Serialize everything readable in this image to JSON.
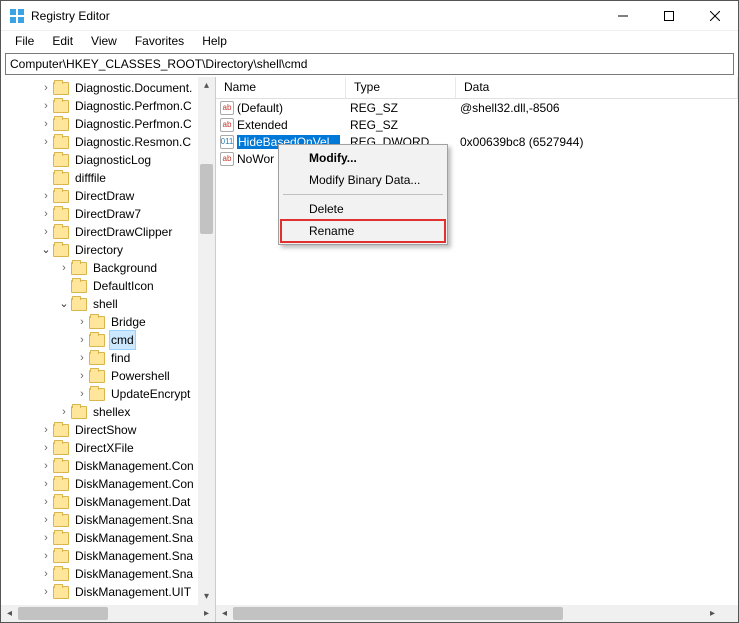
{
  "window": {
    "title": "Registry Editor"
  },
  "menu": {
    "file": "File",
    "edit": "Edit",
    "view": "View",
    "favorites": "Favorites",
    "help": "Help"
  },
  "address": "Computer\\HKEY_CLASSES_ROOT\\Directory\\shell\\cmd",
  "columns": {
    "name": "Name",
    "type": "Type",
    "data": "Data"
  },
  "values": [
    {
      "icon": "str",
      "name": "(Default)",
      "type": "REG_SZ",
      "data": "@shell32.dll,-8506",
      "selected": false
    },
    {
      "icon": "str",
      "name": "Extended",
      "type": "REG_SZ",
      "data": "",
      "selected": false
    },
    {
      "icon": "bin",
      "name": "HideBasedOnVel...",
      "type": "REG_DWORD",
      "data": "0x00639bc8 (6527944)",
      "selected": true
    },
    {
      "icon": "str",
      "name": "NoWor",
      "type": "",
      "data": "",
      "selected": false
    }
  ],
  "context_menu": {
    "modify": "Modify...",
    "modify_binary": "Modify Binary Data...",
    "delete": "Delete",
    "rename": "Rename"
  },
  "tree": [
    {
      "depth": 0,
      "tw": ">",
      "label": "Diagnostic.Document."
    },
    {
      "depth": 0,
      "tw": ">",
      "label": "Diagnostic.Perfmon.C"
    },
    {
      "depth": 0,
      "tw": ">",
      "label": "Diagnostic.Perfmon.C"
    },
    {
      "depth": 0,
      "tw": ">",
      "label": "Diagnostic.Resmon.C"
    },
    {
      "depth": 0,
      "tw": "",
      "label": "DiagnosticLog"
    },
    {
      "depth": 0,
      "tw": "",
      "label": "difffile"
    },
    {
      "depth": 0,
      "tw": ">",
      "label": "DirectDraw"
    },
    {
      "depth": 0,
      "tw": ">",
      "label": "DirectDraw7"
    },
    {
      "depth": 0,
      "tw": ">",
      "label": "DirectDrawClipper"
    },
    {
      "depth": 0,
      "tw": "v",
      "label": "Directory"
    },
    {
      "depth": 1,
      "tw": ">",
      "label": "Background"
    },
    {
      "depth": 1,
      "tw": "",
      "label": "DefaultIcon"
    },
    {
      "depth": 1,
      "tw": "v",
      "label": "shell"
    },
    {
      "depth": 2,
      "tw": ">",
      "label": "Bridge"
    },
    {
      "depth": 2,
      "tw": ">",
      "label": "cmd",
      "selected": true
    },
    {
      "depth": 2,
      "tw": ">",
      "label": "find"
    },
    {
      "depth": 2,
      "tw": ">",
      "label": "Powershell"
    },
    {
      "depth": 2,
      "tw": ">",
      "label": "UpdateEncrypt"
    },
    {
      "depth": 1,
      "tw": ">",
      "label": "shellex"
    },
    {
      "depth": 0,
      "tw": ">",
      "label": "DirectShow"
    },
    {
      "depth": 0,
      "tw": ">",
      "label": "DirectXFile"
    },
    {
      "depth": 0,
      "tw": ">",
      "label": "DiskManagement.Con"
    },
    {
      "depth": 0,
      "tw": ">",
      "label": "DiskManagement.Con"
    },
    {
      "depth": 0,
      "tw": ">",
      "label": "DiskManagement.Dat"
    },
    {
      "depth": 0,
      "tw": ">",
      "label": "DiskManagement.Sna"
    },
    {
      "depth": 0,
      "tw": ">",
      "label": "DiskManagement.Sna"
    },
    {
      "depth": 0,
      "tw": ">",
      "label": "DiskManagement.Sna"
    },
    {
      "depth": 0,
      "tw": ">",
      "label": "DiskManagement.Sna"
    },
    {
      "depth": 0,
      "tw": ">",
      "label": "DiskManagement.UIT"
    }
  ]
}
